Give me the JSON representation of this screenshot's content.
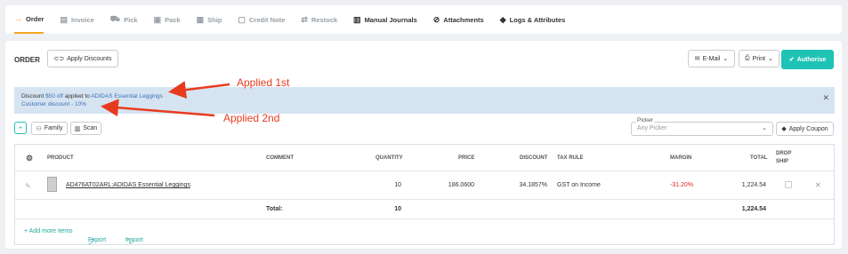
{
  "tabs": [
    {
      "label": "Order",
      "icon": "arrow-right-icon"
    },
    {
      "label": "Invoice",
      "icon": "invoice-icon"
    },
    {
      "label": "Pick",
      "icon": "cart-icon"
    },
    {
      "label": "Pack",
      "icon": "box-icon"
    },
    {
      "label": "Ship",
      "icon": "truck-icon"
    },
    {
      "label": "Credit Note",
      "icon": "credit-note-icon"
    },
    {
      "label": "Restock",
      "icon": "restock-icon"
    },
    {
      "label": "Manual Journals",
      "icon": "journal-icon"
    },
    {
      "label": "Attachments",
      "icon": "paperclip-icon"
    },
    {
      "label": "Logs & Attributes",
      "icon": "tag-icon"
    }
  ],
  "order": {
    "title": "ORDER",
    "apply_discounts": "Apply Discounts",
    "email": "E-Mail",
    "print": "Print",
    "authorise": "Authorise"
  },
  "banner": {
    "line1_prefix": "Discount",
    "line1_amount": "$50 off",
    "line1_mid": "applied to",
    "line1_product": "ADIDAS Essential Leggings",
    "line2": "Customer discount - 10%"
  },
  "annotations": {
    "first": "Applied 1st",
    "second": "Applied 2nd"
  },
  "toolbar": {
    "add": "+",
    "family": "Family",
    "scan": "Scan",
    "picker_label": "Picker",
    "picker_placeholder": "Any Picker",
    "apply_coupon": "Apply Coupon"
  },
  "table": {
    "headers": {
      "product": "PRODUCT",
      "comment": "COMMENT",
      "quantity": "QUANTITY",
      "price": "PRICE",
      "discount": "DISCOUNT",
      "tax_rule": "TAX RULE",
      "margin": "MARGIN",
      "total": "TOTAL",
      "drop": "DROP",
      "ship": "SHIP"
    },
    "rows": [
      {
        "product": "AD476AT02ARL:ADIDAS Essential Leggings",
        "quantity": "10",
        "price": "186.0600",
        "discount": "34.1857%",
        "tax_rule": "GST on Income",
        "margin": "-31.20%",
        "total": "1,224.54"
      }
    ],
    "totals": {
      "label": "Total:",
      "quantity": "10",
      "total": "1,224.54"
    },
    "footer": {
      "add_more": "+ Add more items",
      "export": "Export",
      "import": "Import"
    }
  },
  "colors": {
    "accent": "#1fc3b6",
    "tab_active": "#f5a623",
    "annotation": "#e83b1e",
    "banner_bg": "#d6e4f2",
    "margin_negative": "#e0252b"
  }
}
